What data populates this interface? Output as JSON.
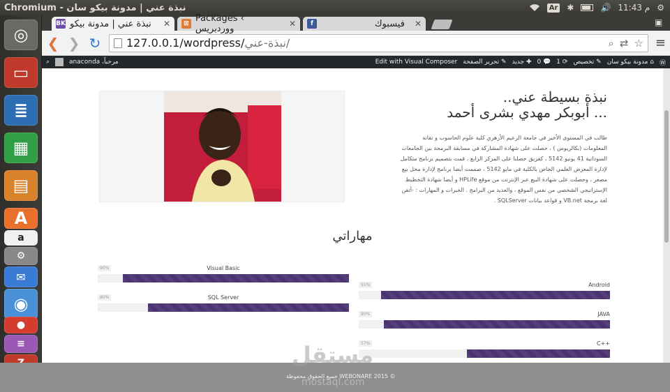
{
  "window_title": "Chromium - نبذة عني | مدونة بيكو سان",
  "panel": {
    "keyboard": "Ar",
    "time": "11:43 م"
  },
  "tabs": [
    {
      "label": "نبذة عني | مدونة بيكو",
      "favicon": "BK",
      "favicon_color": "#6b4aa8",
      "active": true
    },
    {
      "label": "Packages ‹ ووردبريس",
      "favicon": "⊠",
      "favicon_color": "#e07b39",
      "active": false
    },
    {
      "label": "فيسبوك",
      "favicon": "f",
      "favicon_color": "#3b5998",
      "active": false
    }
  ],
  "url": {
    "host": "127.0.0.1/wordpress/",
    "path": "نبذة-عني/"
  },
  "adminbar": {
    "greeting": "مرحباً، anaconda",
    "site": "مدونة بيكو سان",
    "customize": "تخصيص",
    "updates": "1",
    "comments": "0",
    "new": "جديد",
    "edit_page": "تحرير الصفحة",
    "visual_composer": "Edit with Visual Composer"
  },
  "bio": {
    "heading1": "نبذة بسيطة عني..",
    "heading2": "... أبوبكر مهدي بشرى أحمد",
    "paragraph": "طالب في المستوى الأخير في جامعة الزعيم الأزهري كلية علوم الحاسوب و تقانة المعلومات (بكالريوس ) ، حصلت على شهادة المشاركة في مسابقة البرمجة بين الجامعات السودانية 41 يونيو 5142 ، كفريق حصلنا على المركز الرابع ، قمت بتصميم برنامج متكامل لإدارة المعرض العلمي الخاص بالكلية في مايو 5142 ، صممت أيضا برنامج لإدارة محل بيع مصغر ، وحصلت على شهادة البيع عبر الإنترنت من موقع HPLife و أيضا شهادة التخطيط الإستراتيجي الشخصي من نفس الموقع ، والعديد من البرامج . الخبرات و المهارات : -أتقن لغة برمجة VB.net و قواعد بيانات SQLServer ."
  },
  "skills": {
    "title": "مهاراتي",
    "items": [
      {
        "name": "Visual Basic",
        "percent_label": "90%",
        "value": 90
      },
      {
        "name": "SQL Server",
        "percent_label": "80%",
        "value": 80
      },
      {
        "name": "Android",
        "percent_label": "91%",
        "value": 91
      },
      {
        "name": "JAVA",
        "percent_label": "90%",
        "value": 90
      },
      {
        "name": "C++",
        "percent_label": "57%",
        "value": 57
      }
    ]
  },
  "footer": {
    "text": "جميع الحقوق محفوظة WEBONARE 2015 ©"
  },
  "watermark": {
    "main": "مستقل",
    "sub": "mostaql.com"
  }
}
